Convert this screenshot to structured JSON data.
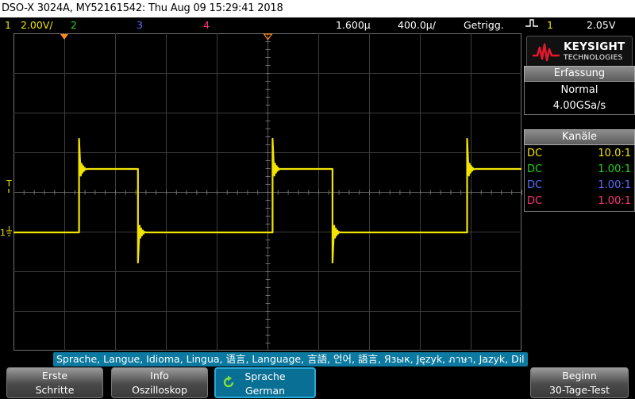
{
  "title": "DSO-X 3024A, MY52161542: Thu Aug 09 15:29:41 2018",
  "status": {
    "ch1_num": "1",
    "ch1_scale": "2.00V/",
    "ch2_num": "2",
    "ch3_num": "3",
    "ch4_num": "4",
    "time_delay": "1.600µ",
    "time_scale": "400.0µ/",
    "trigger_state": "Getrigg.",
    "trigger_source": "1",
    "trigger_level": "2.05V"
  },
  "logo": {
    "brand": "KEYSIGHT",
    "sub": "TECHNOLOGIES"
  },
  "acquisition": {
    "header": "Erfassung",
    "mode": "Normal",
    "rate": "4.00GSa/s"
  },
  "channels": {
    "header": "Kanäle",
    "rows": [
      {
        "coupling": "DC",
        "probe": "10.0:1"
      },
      {
        "coupling": "DC",
        "probe": "1.00:1"
      },
      {
        "coupling": "DC",
        "probe": "1.00:1"
      },
      {
        "coupling": "DC",
        "probe": "1.00:1"
      }
    ]
  },
  "markers": {
    "trigger_level": "T",
    "ch1_ground": "1"
  },
  "language_bar": "Sprache, Langue, Idioma, Lingua, 语言, Language, 言語, 언어, 語言, Язык, Język, ภาษา, Jazyk, Dil",
  "softkeys": {
    "k1_line1": "Erste",
    "k1_line2": "Schritte",
    "k2_line1": "Info",
    "k2_line2": "Oszilloskop",
    "k3_line1": "Sprache",
    "k3_line2": "German",
    "k5_line1": "Beginn",
    "k5_line2": "30-Tage-Test"
  },
  "colors": {
    "ch1": "#f2e400",
    "ch2": "#23d321",
    "ch3": "#5b6dff",
    "ch4": "#ff3577",
    "trigger_marker": "#ff8a1f"
  },
  "waveform": {
    "channel": "1",
    "scale_v_per_div": 2.0,
    "time_per_div_us": 400,
    "low_level_div": 0.0,
    "high_level_div": 1.6,
    "transitions_div": [
      {
        "t": 1.29,
        "edge": "rising"
      },
      {
        "t": 2.45,
        "edge": "falling"
      },
      {
        "t": 5.1,
        "edge": "rising"
      },
      {
        "t": 6.28,
        "edge": "falling"
      },
      {
        "t": 8.93,
        "edge": "rising"
      }
    ],
    "start_level": "low"
  }
}
